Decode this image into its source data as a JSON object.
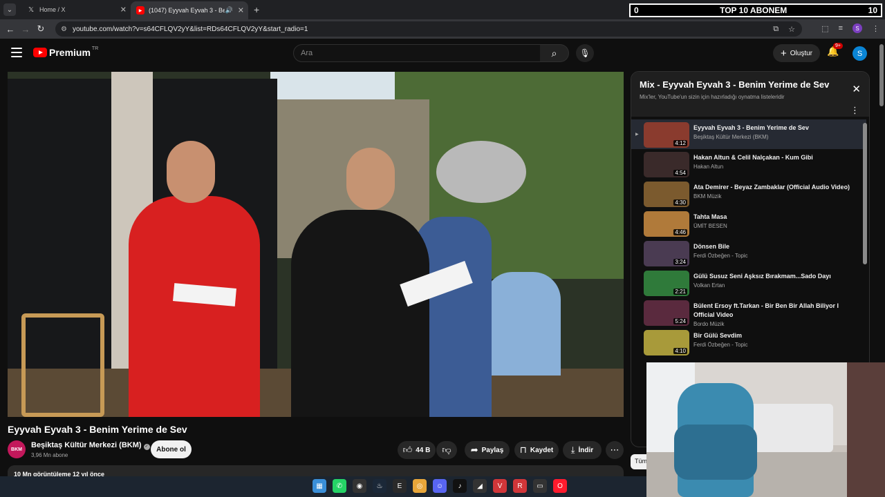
{
  "browser": {
    "tabs": [
      {
        "title": "Home / X",
        "icon": "x-logo-icon"
      },
      {
        "title": "(1047) Eyyvah Eyvah 3 - Ben",
        "icon": "youtube-icon"
      }
    ],
    "url": "youtube.com/watch?v=s64CFLQV2yY&list=RDs64CFLQV2yY&start_radio=1",
    "profile_letter": "S"
  },
  "stream_overlay": {
    "left": "0",
    "title": "TOP 10 ABONEM",
    "right": "10"
  },
  "youtube_header": {
    "logo": "Premium",
    "logo_region": "TR",
    "search_placeholder": "Ara",
    "create_label": "Oluştur",
    "notif_badge": "9+",
    "avatar_letter": "S"
  },
  "video": {
    "title": "Eyyvah Eyvah 3 - Benim Yerime de Sev",
    "channel_name": "Beşiktaş Kültür Merkezi (BKM)",
    "channel_avatar": "BKM",
    "subscribers": "3,96 Mn abone",
    "subscribe_label": "Abone ol",
    "likes": "44 B",
    "share_label": "Paylaş",
    "save_label": "Kaydet",
    "download_label": "İndir",
    "description_summary": "10 Mn görüntüleme  12 yıl önce"
  },
  "playlist": {
    "title": "Mix - Eyyvah Eyvah 3 - Benim Yerime de Sev",
    "subtitle": "Mix'ler, YouTube'un sizin için hazırladığı oynatma listeleridir",
    "items": [
      {
        "title": "Eyyvah Eyvah 3 - Benim Yerime de Sev",
        "channel": "Beşiktaş Kültür Merkezi (BKM)",
        "duration": "4:12",
        "color": "#8a3b2e"
      },
      {
        "title": "Hakan Altun & Celil Nalçakan - Kum Gibi",
        "channel": "Hakan Altun",
        "duration": "4:54",
        "color": "#3a2a2a"
      },
      {
        "title": "Ata Demirer - Beyaz Zambaklar (Official Audio Video)",
        "channel": "BKM Müzik",
        "duration": "4:30",
        "color": "#7b5a2e"
      },
      {
        "title": "Tahta Masa",
        "channel": "ÜMİT BESEN",
        "duration": "4:46",
        "color": "#b07a3a"
      },
      {
        "title": "Dönsen Bile",
        "channel": "Ferdi Özbeğen - Topic",
        "duration": "3:24",
        "color": "#4a3b52"
      },
      {
        "title": "Gülü Susuz Seni Aşksız Bırakmam...Sado Dayı",
        "channel": "Volkan Ertan",
        "duration": "2:21",
        "color": "#2f7a3a"
      },
      {
        "title": "Bülent Ersoy ft.Tarkan - Bir Ben Bir Allah Biliyor I Official Video",
        "channel": "Bordo Müzik",
        "duration": "5:24",
        "color": "#5a2a3e"
      },
      {
        "title": "Bir Gülü Sevdim",
        "channel": "Ferdi Özbeğen - Topic",
        "duration": "4:10",
        "color": "#a89a3a"
      }
    ]
  },
  "bottom_chip": "Tüm",
  "taskbar": {
    "apps": [
      {
        "icon": "windows-start-icon",
        "color": "#3a8fd8",
        "glyph": "▦"
      },
      {
        "icon": "whatsapp-icon",
        "color": "#25d366",
        "glyph": "✆"
      },
      {
        "icon": "obs-icon",
        "color": "#333333",
        "glyph": "◉"
      },
      {
        "icon": "steam-icon",
        "color": "#1b2838",
        "glyph": "♨"
      },
      {
        "icon": "epic-games-icon",
        "color": "#2a2a2a",
        "glyph": "E"
      },
      {
        "icon": "chrome-icon",
        "color": "#e8a63a",
        "glyph": "◎"
      },
      {
        "icon": "discord-icon",
        "color": "#5865f2",
        "glyph": "☺"
      },
      {
        "icon": "tiktok-icon",
        "color": "#111111",
        "glyph": "♪"
      },
      {
        "icon": "lightshot-icon",
        "color": "#333333",
        "glyph": "◢"
      },
      {
        "icon": "valorant-icon",
        "color": "#d13639",
        "glyph": "V"
      },
      {
        "icon": "riot-icon",
        "color": "#d13639",
        "glyph": "R"
      },
      {
        "icon": "terminal-icon",
        "color": "#333333",
        "glyph": "▭"
      },
      {
        "icon": "opera-icon",
        "color": "#ff1b2d",
        "glyph": "O"
      }
    ]
  }
}
